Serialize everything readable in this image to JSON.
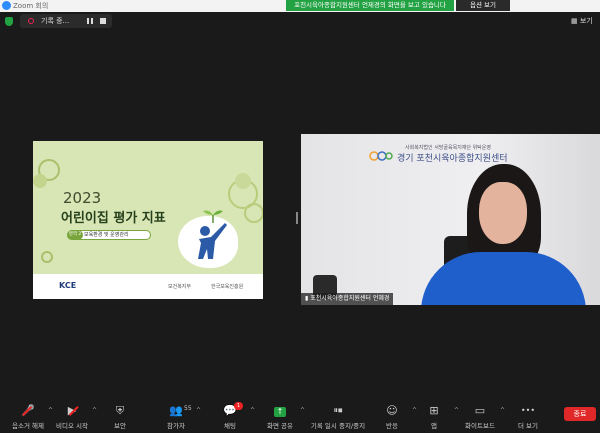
{
  "window": {
    "title": "Zoom 회의",
    "share_banner": "포천시육아종합지원센터 언제경의 화면을 보고 있습니다",
    "options_label": "옵션 보기"
  },
  "meeting_bar": {
    "record_label": "기록 중...",
    "view_label": "보기"
  },
  "slide": {
    "year": "2023",
    "title": "어린이집 평가 지표",
    "tag_badge": "영역 2",
    "tag_text": "보육환경 및 운영관리",
    "logo_left": "KCE",
    "logo_gov": "보건복지부",
    "logo_org": "한국보육진흥원"
  },
  "camera": {
    "sub_text": "사회복지법인 서방골육목지재단 위탁운영",
    "org_name": "경기 포천시육아종합지원센터",
    "participant_label": "포천시육아종합지원센터 언혜경"
  },
  "toolbar": {
    "items": [
      {
        "label": "음소거 해제",
        "icon": "mic-muted-icon",
        "glyph": "🎤"
      },
      {
        "label": "비디오 시작",
        "icon": "video-off-icon",
        "glyph": "📷"
      },
      {
        "label": "보안",
        "icon": "shield-icon",
        "glyph": "⛨"
      },
      {
        "label": "참가자",
        "icon": "participants-icon",
        "glyph": "👥",
        "count": "55"
      },
      {
        "label": "채팅",
        "icon": "chat-icon",
        "glyph": "💬",
        "badge": "1"
      },
      {
        "label": "화면 공유",
        "icon": "share-screen-icon",
        "glyph": "↑"
      },
      {
        "label": "기록 일시 중지/중지",
        "icon": "record-icon",
        "glyph": "⏸⏹"
      },
      {
        "label": "반응",
        "icon": "reaction-icon",
        "glyph": "☺"
      },
      {
        "label": "앱",
        "icon": "apps-icon",
        "glyph": "⊞"
      },
      {
        "label": "화이트보드",
        "icon": "whiteboard-icon",
        "glyph": "▭"
      },
      {
        "label": "더 보기",
        "icon": "more-icon",
        "glyph": "•••"
      }
    ],
    "end_label": "종료"
  }
}
